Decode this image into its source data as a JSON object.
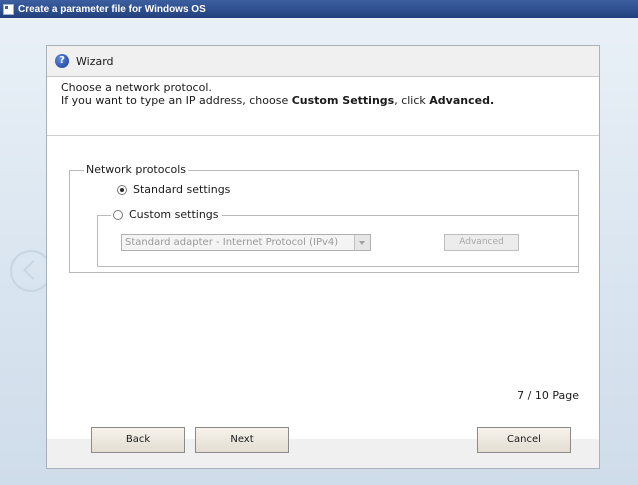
{
  "window": {
    "title": "Create a parameter file for Windows OS"
  },
  "wizard": {
    "title": "Wizard",
    "instruction_line1": "Choose a network protocol.",
    "instruction_line2_prefix": "If you want to type an IP address, choose ",
    "instruction_line2_bold1": "Custom Settings",
    "instruction_line2_mid": ", click ",
    "instruction_line2_bold2": "Advanced.",
    "group_label": "Network protocols",
    "standard_option": "Standard settings",
    "custom_option": "Custom settings",
    "selected_option": "standard",
    "adapter_select_value": "Standard adapter - Internet Protocol (IPv4)",
    "advanced_label": "Advanced",
    "page_indicator": "7 / 10 Page",
    "back_label": "Back",
    "next_label": "Next",
    "cancel_label": "Cancel"
  },
  "icons": {
    "help": "help-icon",
    "app": "app-icon"
  },
  "colors": {
    "titlebar": "#22407d",
    "help_icon": "#1c3e93"
  }
}
